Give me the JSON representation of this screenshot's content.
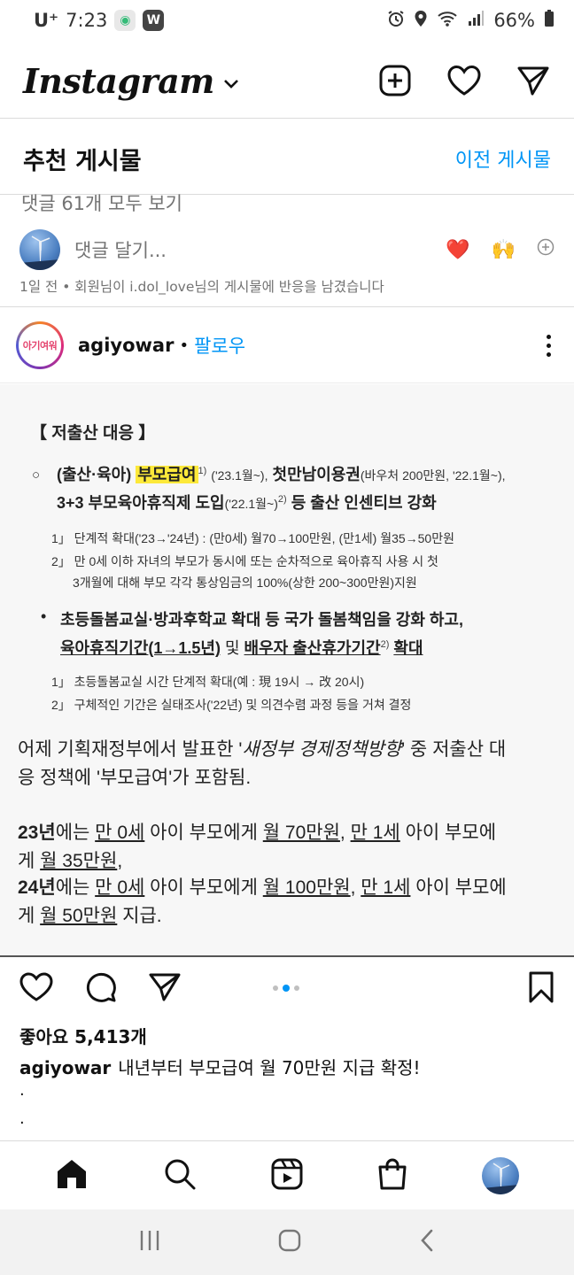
{
  "status_bar": {
    "carrier": "U⁺",
    "time": "7:23",
    "battery": "66%"
  },
  "header": {
    "logo": "Instagram"
  },
  "suggested": {
    "title": "추천 게시물",
    "previous_link": "이전 게시물"
  },
  "previous_post": {
    "view_comments": "댓글 61개 모두 보기",
    "comment_placeholder": "댓글 달기...",
    "quick_reacts": [
      "❤️",
      "🙌"
    ],
    "activity": "1일 전 • 회원님이 i.dol_love님의 게시물에 반응을 남겼습니다"
  },
  "post": {
    "avatar_text": "아기여워",
    "username": "agiyowar",
    "dot": "•",
    "follow": "팔로우",
    "likes": "좋아요 5,413개",
    "caption_user": "agiyowar",
    "caption_text": "내년부터 부모급여 월 70만원 지급 확정!",
    "caption_more": [
      "·",
      "·"
    ],
    "carousel": {
      "count": 3,
      "active": 2
    },
    "image": {
      "title": "【 저출산 대응 】",
      "bullet1": "○",
      "line1_a": "(출산·육아)",
      "line1_hl": "부모급여",
      "line1_b": "('23.1월~),",
      "line1_c": "첫만남이용권",
      "line1_d": "(바우처 200만원, '22.1월~),",
      "line2_a": "3+3 부모육아휴직제 도입",
      "line2_b": "('22.1월~)",
      "line2_c": "등 출산 인센티브 강화",
      "note1": "1」 단계적 확대('23→'24년) : (만0세) 월70→100만원, (만1세) 월35→50만원",
      "note2a": "2」 만 0세 이하 자녀의 부모가 동시에 또는 순차적으로 육아휴직 사용 시 첫",
      "note2b": "3개월에 대해 부모 각각 통상임금의 100%(상한 200~300만원)지원",
      "bullet2": "•",
      "line3": "초등돌봄교실·방과후학교 확대 등 국가 돌봄책임을 강화 하고,",
      "line4_a": "육아휴직기간(1→1.5년)",
      "line4_b": "및",
      "line4_c": "배우자 출산휴가기간",
      "line4_d": "확대",
      "note3": "1」 초등돌봄교실 시간 단계적 확대(예 : 現 19시 → 改 20시)",
      "note4": "2」 구체적인 기간은 실태조사('22년) 및 의견수렴 과정 등을 거쳐 결정",
      "hand1_a": "어제 기획재정부에서 발표한 '",
      "hand1_i": "새정부 경제정책방향",
      "hand1_b": "' 중 저출산 대",
      "hand2": "응 정책에 '부모급여'가 포함됨.",
      "hand3_a": "23년",
      "hand3_b": "에는 ",
      "hand3_c": "만 0세",
      "hand3_d": " 아이 부모에게 ",
      "hand3_e": "월 70만원",
      "hand3_f": ", ",
      "hand3_g": "만 1세",
      "hand3_h": " 아이 부모에",
      "hand4_a": "게 ",
      "hand4_b": "월 35만원",
      "hand4_c": ",",
      "hand5_a": "24년",
      "hand5_b": "에는 ",
      "hand5_c": "만 0세",
      "hand5_d": " 아이 부모에게 ",
      "hand5_e": "월 100만원",
      "hand5_f": ", ",
      "hand5_g": "만 1세",
      "hand5_h": " 아이 부모에",
      "hand6_a": "게 ",
      "hand6_b": "월 50만원",
      "hand6_c": " 지급."
    }
  },
  "colors": {
    "link_blue": "#0095f6",
    "secondary_text": "#737373",
    "highlight": "#fde93a"
  }
}
